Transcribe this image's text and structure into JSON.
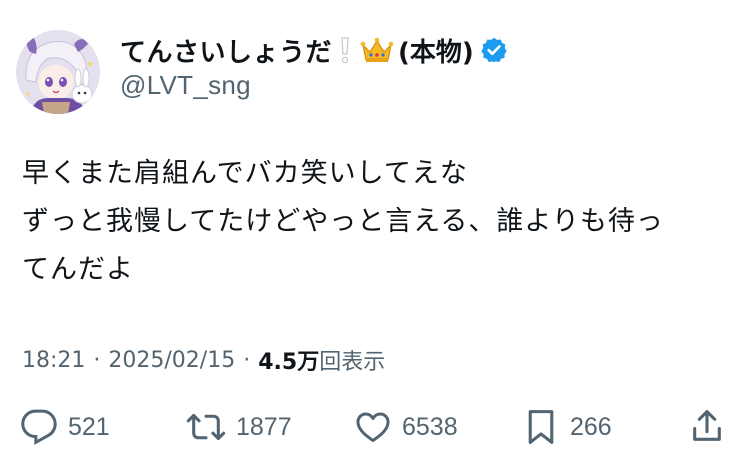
{
  "user": {
    "display_name": "てんさいしょうだ",
    "name_suffix": "(本物)",
    "handle": "@LVT_sng",
    "verified": true,
    "verified_color": "#1d9bf0"
  },
  "tweet": {
    "lines": [
      "早くまた肩組んでバカ笑いしてえな",
      "ずっと我慢してたけどやっと言える、誰よりも待っ",
      "てんだよ"
    ]
  },
  "meta": {
    "time": "18:21",
    "separator": "·",
    "date": "2025/02/15",
    "views_count": "4.5万",
    "views_label": "回表示"
  },
  "actions": {
    "replies": "521",
    "retweets": "1877",
    "likes": "6538",
    "bookmarks": "266"
  },
  "icons": {
    "reply": "reply-icon",
    "retweet": "retweet-icon",
    "like": "heart-icon",
    "bookmark": "bookmark-icon",
    "share": "share-icon",
    "emoji_exclaim": "white-exclamation-icon",
    "emoji_crown": "crown-icon",
    "verified": "verified-badge-icon"
  },
  "colors": {
    "text_primary": "#0f1419",
    "text_secondary": "#536471"
  }
}
